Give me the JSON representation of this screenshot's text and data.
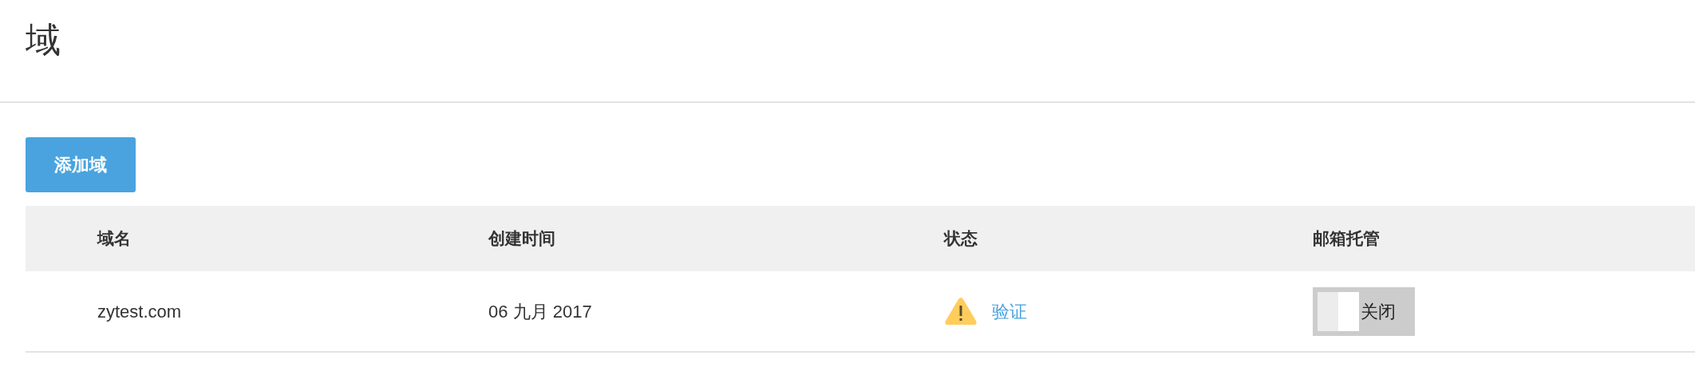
{
  "page_title": "域",
  "add_button": "添加域",
  "table": {
    "columns": [
      "域名",
      "创建时间",
      "状态",
      "邮箱托管"
    ],
    "rows": [
      {
        "domain": "zytest.com",
        "created": "06 九月 2017",
        "status": {
          "kind": "warning",
          "action": "验证"
        },
        "hosting": {
          "on": false,
          "label": "关闭"
        }
      }
    ]
  }
}
